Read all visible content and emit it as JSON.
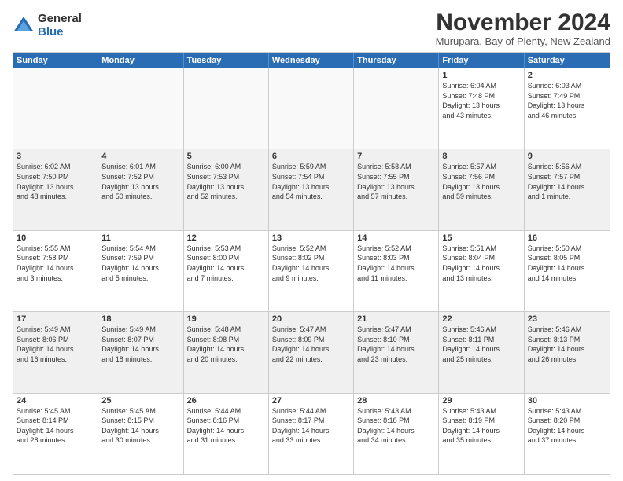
{
  "logo": {
    "general": "General",
    "blue": "Blue"
  },
  "title": "November 2024",
  "subtitle": "Murupara, Bay of Plenty, New Zealand",
  "header_days": [
    "Sunday",
    "Monday",
    "Tuesday",
    "Wednesday",
    "Thursday",
    "Friday",
    "Saturday"
  ],
  "weeks": [
    [
      {
        "day": "",
        "info": "",
        "empty": true
      },
      {
        "day": "",
        "info": "",
        "empty": true
      },
      {
        "day": "",
        "info": "",
        "empty": true
      },
      {
        "day": "",
        "info": "",
        "empty": true
      },
      {
        "day": "",
        "info": "",
        "empty": true
      },
      {
        "day": "1",
        "info": "Sunrise: 6:04 AM\nSunset: 7:48 PM\nDaylight: 13 hours\nand 43 minutes."
      },
      {
        "day": "2",
        "info": "Sunrise: 6:03 AM\nSunset: 7:49 PM\nDaylight: 13 hours\nand 46 minutes."
      }
    ],
    [
      {
        "day": "3",
        "info": "Sunrise: 6:02 AM\nSunset: 7:50 PM\nDaylight: 13 hours\nand 48 minutes."
      },
      {
        "day": "4",
        "info": "Sunrise: 6:01 AM\nSunset: 7:52 PM\nDaylight: 13 hours\nand 50 minutes."
      },
      {
        "day": "5",
        "info": "Sunrise: 6:00 AM\nSunset: 7:53 PM\nDaylight: 13 hours\nand 52 minutes."
      },
      {
        "day": "6",
        "info": "Sunrise: 5:59 AM\nSunset: 7:54 PM\nDaylight: 13 hours\nand 54 minutes."
      },
      {
        "day": "7",
        "info": "Sunrise: 5:58 AM\nSunset: 7:55 PM\nDaylight: 13 hours\nand 57 minutes."
      },
      {
        "day": "8",
        "info": "Sunrise: 5:57 AM\nSunset: 7:56 PM\nDaylight: 13 hours\nand 59 minutes."
      },
      {
        "day": "9",
        "info": "Sunrise: 5:56 AM\nSunset: 7:57 PM\nDaylight: 14 hours\nand 1 minute."
      }
    ],
    [
      {
        "day": "10",
        "info": "Sunrise: 5:55 AM\nSunset: 7:58 PM\nDaylight: 14 hours\nand 3 minutes."
      },
      {
        "day": "11",
        "info": "Sunrise: 5:54 AM\nSunset: 7:59 PM\nDaylight: 14 hours\nand 5 minutes."
      },
      {
        "day": "12",
        "info": "Sunrise: 5:53 AM\nSunset: 8:00 PM\nDaylight: 14 hours\nand 7 minutes."
      },
      {
        "day": "13",
        "info": "Sunrise: 5:52 AM\nSunset: 8:02 PM\nDaylight: 14 hours\nand 9 minutes."
      },
      {
        "day": "14",
        "info": "Sunrise: 5:52 AM\nSunset: 8:03 PM\nDaylight: 14 hours\nand 11 minutes."
      },
      {
        "day": "15",
        "info": "Sunrise: 5:51 AM\nSunset: 8:04 PM\nDaylight: 14 hours\nand 13 minutes."
      },
      {
        "day": "16",
        "info": "Sunrise: 5:50 AM\nSunset: 8:05 PM\nDaylight: 14 hours\nand 14 minutes."
      }
    ],
    [
      {
        "day": "17",
        "info": "Sunrise: 5:49 AM\nSunset: 8:06 PM\nDaylight: 14 hours\nand 16 minutes."
      },
      {
        "day": "18",
        "info": "Sunrise: 5:49 AM\nSunset: 8:07 PM\nDaylight: 14 hours\nand 18 minutes."
      },
      {
        "day": "19",
        "info": "Sunrise: 5:48 AM\nSunset: 8:08 PM\nDaylight: 14 hours\nand 20 minutes."
      },
      {
        "day": "20",
        "info": "Sunrise: 5:47 AM\nSunset: 8:09 PM\nDaylight: 14 hours\nand 22 minutes."
      },
      {
        "day": "21",
        "info": "Sunrise: 5:47 AM\nSunset: 8:10 PM\nDaylight: 14 hours\nand 23 minutes."
      },
      {
        "day": "22",
        "info": "Sunrise: 5:46 AM\nSunset: 8:11 PM\nDaylight: 14 hours\nand 25 minutes."
      },
      {
        "day": "23",
        "info": "Sunrise: 5:46 AM\nSunset: 8:13 PM\nDaylight: 14 hours\nand 26 minutes."
      }
    ],
    [
      {
        "day": "24",
        "info": "Sunrise: 5:45 AM\nSunset: 8:14 PM\nDaylight: 14 hours\nand 28 minutes."
      },
      {
        "day": "25",
        "info": "Sunrise: 5:45 AM\nSunset: 8:15 PM\nDaylight: 14 hours\nand 30 minutes."
      },
      {
        "day": "26",
        "info": "Sunrise: 5:44 AM\nSunset: 8:16 PM\nDaylight: 14 hours\nand 31 minutes."
      },
      {
        "day": "27",
        "info": "Sunrise: 5:44 AM\nSunset: 8:17 PM\nDaylight: 14 hours\nand 33 minutes."
      },
      {
        "day": "28",
        "info": "Sunrise: 5:43 AM\nSunset: 8:18 PM\nDaylight: 14 hours\nand 34 minutes."
      },
      {
        "day": "29",
        "info": "Sunrise: 5:43 AM\nSunset: 8:19 PM\nDaylight: 14 hours\nand 35 minutes."
      },
      {
        "day": "30",
        "info": "Sunrise: 5:43 AM\nSunset: 8:20 PM\nDaylight: 14 hours\nand 37 minutes."
      }
    ]
  ]
}
